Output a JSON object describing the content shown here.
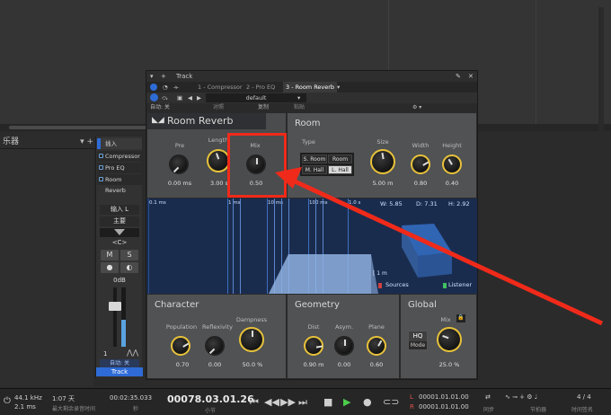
{
  "left_panel": {
    "instruments_title": "乐器",
    "instruments_controls": "▾ +"
  },
  "channel": {
    "inserts_label": "插入",
    "inserts": [
      "Compressor",
      "Pro EQ",
      "Room Reverb"
    ],
    "input": "输入 L",
    "output": "主要",
    "pan": "<C>",
    "mute": "M",
    "solo": "S",
    "record": "●",
    "monitor": "◐",
    "level": "0dB",
    "number": "1",
    "automation": "自动: 关",
    "name": "Track"
  },
  "plugin_window": {
    "title": "Track",
    "tabs": [
      "1 - Compressor",
      "2 - Pro EQ",
      "3 - Room Reverb"
    ],
    "preset": "default",
    "auto_label": "自动: 关",
    "compare_label": "对照",
    "copy_label": "复制",
    "paste_label": "粘贴",
    "plugin_name": "Room Reverb",
    "room_title": "Room",
    "type_label": "Type",
    "types": [
      "S. Room",
      "Room",
      "M. Hall",
      "L. Hall"
    ],
    "active_type": "L. Hall",
    "knobs": {
      "pre": {
        "label": "Pre",
        "value": "0.00 ms"
      },
      "length": {
        "label": "Length",
        "value": "3.00 s"
      },
      "mix_top": {
        "label": "Mix",
        "value": "0.50"
      },
      "size": {
        "label": "Size",
        "value": "5.00 m"
      },
      "width": {
        "label": "Width",
        "value": "0.80"
      },
      "height": {
        "label": "Height",
        "value": "0.40"
      },
      "population": {
        "label": "Population",
        "value": "0.70"
      },
      "reflexivity": {
        "label": "Reflexivity",
        "value": "0.00"
      },
      "dampness": {
        "label": "Dampness",
        "value": "50.0 %"
      },
      "dist": {
        "label": "Dist",
        "value": "0.90 m"
      },
      "asym": {
        "label": "Asym.",
        "value": "0.00"
      },
      "plane": {
        "label": "Plane",
        "value": "0.60"
      },
      "mix_global": {
        "label": "Mix",
        "value": "25.0 %"
      }
    },
    "viz": {
      "ticks": [
        "0.1 ms",
        "1 ms",
        "10 ms",
        "100 ms",
        "1.0 s"
      ],
      "w": "W: 5.85",
      "d": "D: 7.31",
      "h": "H: 2.92",
      "scale": "1 m",
      "sources": "Sources",
      "listener": "Listener"
    },
    "character_title": "Character",
    "geometry_title": "Geometry",
    "global_title": "Global",
    "hq": "HQ",
    "mode": "Mode"
  },
  "transport": {
    "sample_rate": "44.1 kHz",
    "latency": "2.1 ms",
    "days": "1:07 天",
    "days_sub": "最大剩余录音时间",
    "time": "00:02:35.033",
    "time_unit": "秒",
    "position": "00078.03.01.26",
    "position_unit": "小节",
    "loop_l": "00001.01.01.00",
    "loop_r": "00001.01.01.00",
    "sync": "同步",
    "metronome": "节拍器",
    "signature": "4 / 4",
    "signature_sub": "时间签名",
    "l_label": "L",
    "r_label": "R"
  },
  "colors": {
    "accent": "#2e6bd6",
    "annotation": "#f02a1a",
    "knob_arc": "#e8c23a",
    "viz_bg": "#1a2c4e"
  }
}
